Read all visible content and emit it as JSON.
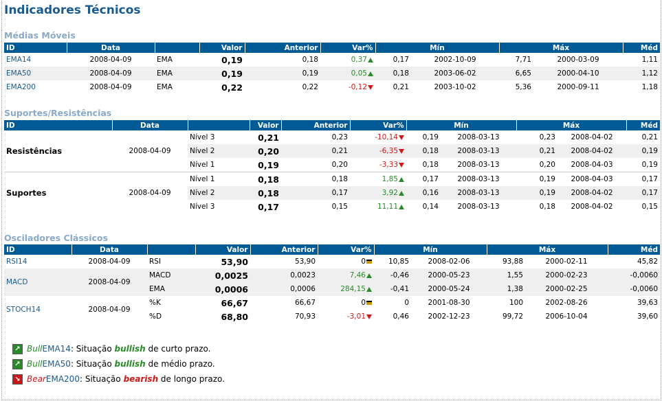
{
  "title": "Indicadores Técnicos",
  "headers": {
    "id": "ID",
    "data": "Data",
    "valor": "Valor",
    "anterior": "Anterior",
    "var": "Var%",
    "min": "Mín",
    "max": "Máx",
    "med": "Méd"
  },
  "medias": {
    "title": "Médias Móveis",
    "rows": [
      {
        "id": "EMA14",
        "data": "2008-04-09",
        "tipo": "EMA",
        "valor": "0,19",
        "anterior": "0,18",
        "var": "0,37",
        "dir": "up",
        "min": "0,17",
        "min_date": "2002-10-09",
        "max": "7,71",
        "max_date": "2000-03-09",
        "med": "1,11"
      },
      {
        "id": "EMA50",
        "data": "2008-04-09",
        "tipo": "EMA",
        "valor": "0,19",
        "anterior": "0,19",
        "var": "0,05",
        "dir": "up",
        "min": "0,18",
        "min_date": "2003-06-02",
        "max": "6,65",
        "max_date": "2000-04-10",
        "med": "1,12"
      },
      {
        "id": "EMA200",
        "data": "2008-04-09",
        "tipo": "EMA",
        "valor": "0,22",
        "anterior": "0,22",
        "var": "-0,12",
        "dir": "down",
        "min": "0,21",
        "min_date": "2003-10-02",
        "max": "5,36",
        "max_date": "2000-09-11",
        "med": "1,18"
      }
    ]
  },
  "suportes": {
    "title": "Suportes/Resistências",
    "resistencias": {
      "label": "Resistências",
      "data": "2008-04-09",
      "rows": [
        {
          "nivel": "Nível 3",
          "valor": "0,21",
          "anterior": "0,23",
          "var": "-10,14",
          "dir": "down",
          "min": "0,19",
          "min_date": "2008-03-13",
          "max": "0,23",
          "max_date": "2008-04-02",
          "med": "0,21"
        },
        {
          "nivel": "Nível 2",
          "valor": "0,20",
          "anterior": "0,21",
          "var": "-6,35",
          "dir": "down",
          "min": "0,18",
          "min_date": "2008-03-13",
          "max": "0,21",
          "max_date": "2008-04-02",
          "med": "0,19"
        },
        {
          "nivel": "Nível 1",
          "valor": "0,19",
          "anterior": "0,20",
          "var": "-3,33",
          "dir": "down",
          "min": "0,18",
          "min_date": "2008-03-13",
          "max": "0,20",
          "max_date": "2008-04-03",
          "med": "0,19"
        }
      ]
    },
    "suportes": {
      "label": "Suportes",
      "data": "2008-04-09",
      "rows": [
        {
          "nivel": "Nível 1",
          "valor": "0,18",
          "anterior": "0,18",
          "var": "1,85",
          "dir": "up",
          "min": "0,17",
          "min_date": "2008-03-13",
          "max": "0,19",
          "max_date": "2008-04-03",
          "med": "0,17"
        },
        {
          "nivel": "Nível 2",
          "valor": "0,18",
          "anterior": "0,17",
          "var": "3,92",
          "dir": "up",
          "min": "0,16",
          "min_date": "2008-03-13",
          "max": "0,19",
          "max_date": "2008-04-02",
          "med": "0,17"
        },
        {
          "nivel": "Nível 3",
          "valor": "0,17",
          "anterior": "0,15",
          "var": "11,11",
          "dir": "up",
          "min": "0,14",
          "min_date": "2008-03-13",
          "max": "0,18",
          "max_date": "2008-04-02",
          "med": "0,15"
        }
      ]
    }
  },
  "osciladores": {
    "title": "Osciladores Clássicos",
    "rsi": {
      "id": "RSI14",
      "data": "2008-04-09",
      "tipo": "RSI",
      "valor": "53,90",
      "anterior": "53,90",
      "var": "0",
      "dir": "eq",
      "min": "10,85",
      "min_date": "2008-02-06",
      "max": "93,88",
      "max_date": "2000-02-11",
      "med": "45,82"
    },
    "macd": {
      "id": "MACD",
      "data": "2008-04-09",
      "rows": [
        {
          "tipo": "MACD",
          "valor": "0,0025",
          "anterior": "0,0023",
          "var": "7,46",
          "dir": "up",
          "min": "-0,46",
          "min_date": "2000-05-23",
          "max": "1,55",
          "max_date": "2000-02-23",
          "med": "-0,0060"
        },
        {
          "tipo": "EMA",
          "valor": "0,0006",
          "anterior": "0,0006",
          "var": "284,15",
          "dir": "up",
          "min": "-0,41",
          "min_date": "2000-05-24",
          "max": "1,38",
          "max_date": "2000-02-25",
          "med": "-0,0060"
        }
      ]
    },
    "stoch": {
      "id": "STOCH14",
      "data": "2008-04-09",
      "rows": [
        {
          "tipo": "%K",
          "valor": "66,67",
          "anterior": "66,67",
          "var": "0",
          "dir": "eq",
          "min": "0",
          "min_date": "2001-08-30",
          "max": "100",
          "max_date": "2002-08-26",
          "med": "39,63"
        },
        {
          "tipo": "%D",
          "valor": "68,80",
          "anterior": "70,93",
          "var": "-3,01",
          "dir": "down",
          "min": "0,46",
          "min_date": "2002-12-23",
          "max": "99,72",
          "max_date": "2006-10-04",
          "med": "39,60"
        }
      ]
    }
  },
  "notes": [
    {
      "kind": "Bull",
      "id": "EMA14",
      "pre": ": Situação ",
      "word": "bullish",
      "post": " de curto prazo."
    },
    {
      "kind": "Bull",
      "id": "EMA50",
      "pre": ": Situação ",
      "word": "bullish",
      "post": " de médio prazo."
    },
    {
      "kind": "Bear",
      "id": "EMA200",
      "pre": ": Situação ",
      "word": "bearish",
      "post": " de longo prazo."
    }
  ]
}
